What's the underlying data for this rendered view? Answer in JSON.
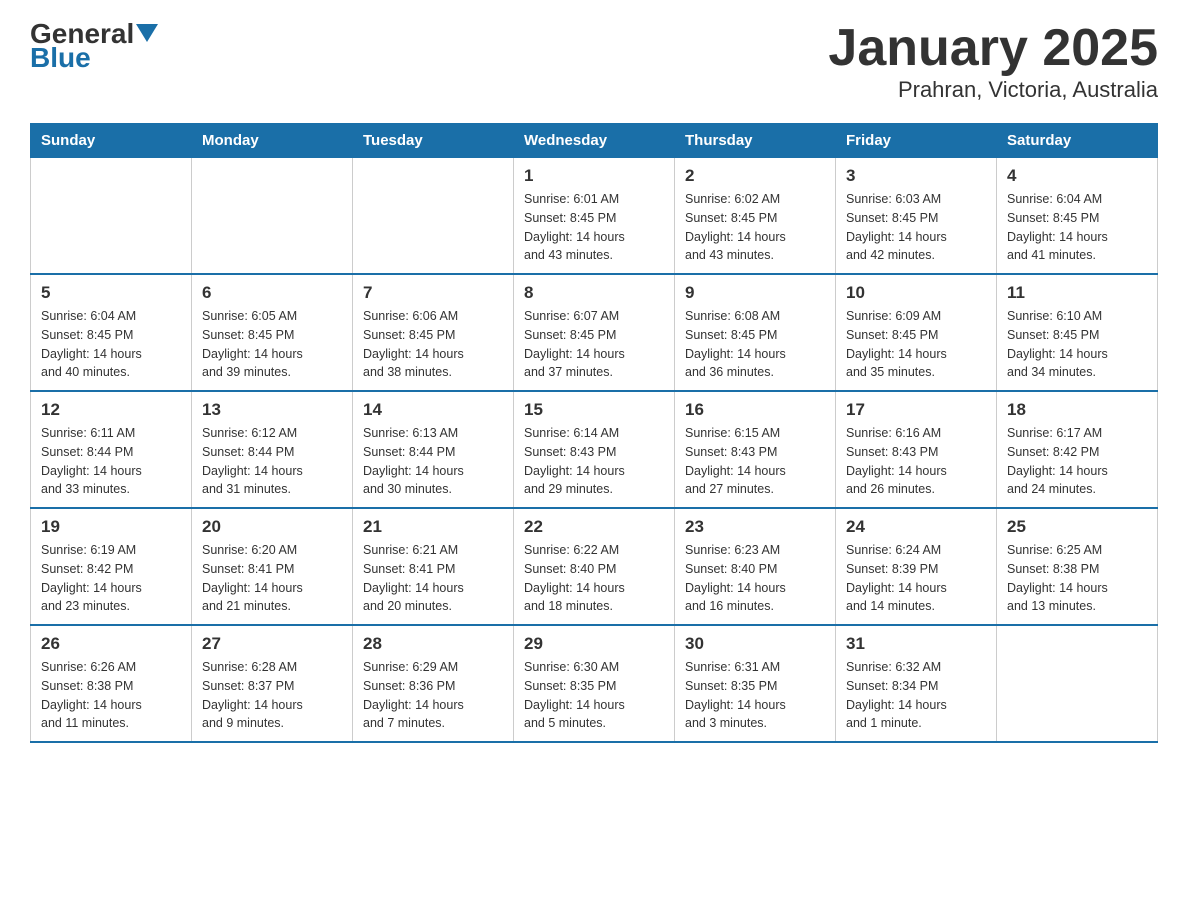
{
  "header": {
    "title": "January 2025",
    "subtitle": "Prahran, Victoria, Australia",
    "logo_general": "General",
    "logo_blue": "Blue"
  },
  "days_of_week": [
    "Sunday",
    "Monday",
    "Tuesday",
    "Wednesday",
    "Thursday",
    "Friday",
    "Saturday"
  ],
  "weeks": [
    [
      {
        "day": "",
        "info": ""
      },
      {
        "day": "",
        "info": ""
      },
      {
        "day": "",
        "info": ""
      },
      {
        "day": "1",
        "info": "Sunrise: 6:01 AM\nSunset: 8:45 PM\nDaylight: 14 hours\nand 43 minutes."
      },
      {
        "day": "2",
        "info": "Sunrise: 6:02 AM\nSunset: 8:45 PM\nDaylight: 14 hours\nand 43 minutes."
      },
      {
        "day": "3",
        "info": "Sunrise: 6:03 AM\nSunset: 8:45 PM\nDaylight: 14 hours\nand 42 minutes."
      },
      {
        "day": "4",
        "info": "Sunrise: 6:04 AM\nSunset: 8:45 PM\nDaylight: 14 hours\nand 41 minutes."
      }
    ],
    [
      {
        "day": "5",
        "info": "Sunrise: 6:04 AM\nSunset: 8:45 PM\nDaylight: 14 hours\nand 40 minutes."
      },
      {
        "day": "6",
        "info": "Sunrise: 6:05 AM\nSunset: 8:45 PM\nDaylight: 14 hours\nand 39 minutes."
      },
      {
        "day": "7",
        "info": "Sunrise: 6:06 AM\nSunset: 8:45 PM\nDaylight: 14 hours\nand 38 minutes."
      },
      {
        "day": "8",
        "info": "Sunrise: 6:07 AM\nSunset: 8:45 PM\nDaylight: 14 hours\nand 37 minutes."
      },
      {
        "day": "9",
        "info": "Sunrise: 6:08 AM\nSunset: 8:45 PM\nDaylight: 14 hours\nand 36 minutes."
      },
      {
        "day": "10",
        "info": "Sunrise: 6:09 AM\nSunset: 8:45 PM\nDaylight: 14 hours\nand 35 minutes."
      },
      {
        "day": "11",
        "info": "Sunrise: 6:10 AM\nSunset: 8:45 PM\nDaylight: 14 hours\nand 34 minutes."
      }
    ],
    [
      {
        "day": "12",
        "info": "Sunrise: 6:11 AM\nSunset: 8:44 PM\nDaylight: 14 hours\nand 33 minutes."
      },
      {
        "day": "13",
        "info": "Sunrise: 6:12 AM\nSunset: 8:44 PM\nDaylight: 14 hours\nand 31 minutes."
      },
      {
        "day": "14",
        "info": "Sunrise: 6:13 AM\nSunset: 8:44 PM\nDaylight: 14 hours\nand 30 minutes."
      },
      {
        "day": "15",
        "info": "Sunrise: 6:14 AM\nSunset: 8:43 PM\nDaylight: 14 hours\nand 29 minutes."
      },
      {
        "day": "16",
        "info": "Sunrise: 6:15 AM\nSunset: 8:43 PM\nDaylight: 14 hours\nand 27 minutes."
      },
      {
        "day": "17",
        "info": "Sunrise: 6:16 AM\nSunset: 8:43 PM\nDaylight: 14 hours\nand 26 minutes."
      },
      {
        "day": "18",
        "info": "Sunrise: 6:17 AM\nSunset: 8:42 PM\nDaylight: 14 hours\nand 24 minutes."
      }
    ],
    [
      {
        "day": "19",
        "info": "Sunrise: 6:19 AM\nSunset: 8:42 PM\nDaylight: 14 hours\nand 23 minutes."
      },
      {
        "day": "20",
        "info": "Sunrise: 6:20 AM\nSunset: 8:41 PM\nDaylight: 14 hours\nand 21 minutes."
      },
      {
        "day": "21",
        "info": "Sunrise: 6:21 AM\nSunset: 8:41 PM\nDaylight: 14 hours\nand 20 minutes."
      },
      {
        "day": "22",
        "info": "Sunrise: 6:22 AM\nSunset: 8:40 PM\nDaylight: 14 hours\nand 18 minutes."
      },
      {
        "day": "23",
        "info": "Sunrise: 6:23 AM\nSunset: 8:40 PM\nDaylight: 14 hours\nand 16 minutes."
      },
      {
        "day": "24",
        "info": "Sunrise: 6:24 AM\nSunset: 8:39 PM\nDaylight: 14 hours\nand 14 minutes."
      },
      {
        "day": "25",
        "info": "Sunrise: 6:25 AM\nSunset: 8:38 PM\nDaylight: 14 hours\nand 13 minutes."
      }
    ],
    [
      {
        "day": "26",
        "info": "Sunrise: 6:26 AM\nSunset: 8:38 PM\nDaylight: 14 hours\nand 11 minutes."
      },
      {
        "day": "27",
        "info": "Sunrise: 6:28 AM\nSunset: 8:37 PM\nDaylight: 14 hours\nand 9 minutes."
      },
      {
        "day": "28",
        "info": "Sunrise: 6:29 AM\nSunset: 8:36 PM\nDaylight: 14 hours\nand 7 minutes."
      },
      {
        "day": "29",
        "info": "Sunrise: 6:30 AM\nSunset: 8:35 PM\nDaylight: 14 hours\nand 5 minutes."
      },
      {
        "day": "30",
        "info": "Sunrise: 6:31 AM\nSunset: 8:35 PM\nDaylight: 14 hours\nand 3 minutes."
      },
      {
        "day": "31",
        "info": "Sunrise: 6:32 AM\nSunset: 8:34 PM\nDaylight: 14 hours\nand 1 minute."
      },
      {
        "day": "",
        "info": ""
      }
    ]
  ]
}
